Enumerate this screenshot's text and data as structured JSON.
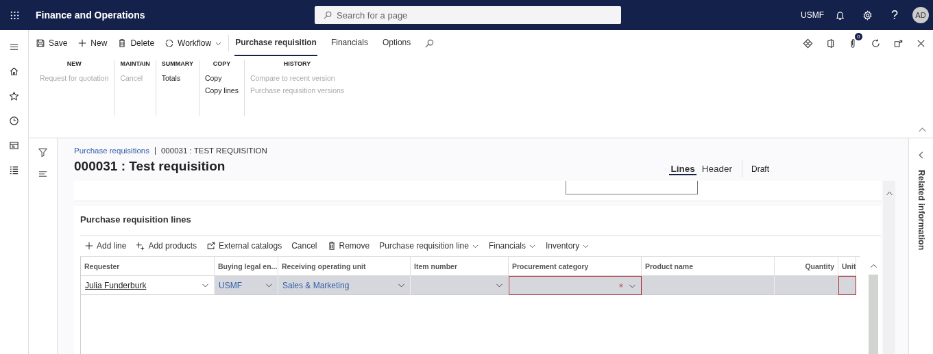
{
  "app": {
    "title": "Finance and Operations",
    "search": {
      "placeholder": "Search for a page"
    },
    "company": "USMF",
    "help": "?",
    "user_initials": "AD"
  },
  "nav_rail": [
    {
      "kind": "menu"
    },
    {
      "kind": "home"
    },
    {
      "kind": "star"
    },
    {
      "kind": "clock"
    },
    {
      "kind": "workspace"
    },
    {
      "kind": "list"
    }
  ],
  "action_pane": {
    "buttons": [
      {
        "label": "Save",
        "kind": "save",
        "dropdown": false
      },
      {
        "label": "New",
        "kind": "plus",
        "dropdown": false
      },
      {
        "label": "Delete",
        "kind": "trash",
        "dropdown": false
      },
      {
        "label": "Workflow",
        "kind": "workflow",
        "dropdown": true
      }
    ],
    "tabs": [
      {
        "label": "Purchase requisition",
        "selected": true
      },
      {
        "label": "Financials",
        "selected": false
      },
      {
        "label": "Options",
        "selected": false
      }
    ],
    "attachments_count": "0",
    "groups": [
      {
        "title": "NEW",
        "items": [
          {
            "label": "Request for quotation",
            "disabled": true
          }
        ]
      },
      {
        "title": "MAINTAIN",
        "items": [
          {
            "label": "Cancel",
            "disabled": true
          }
        ]
      },
      {
        "title": "SUMMARY",
        "items": [
          {
            "label": "Totals",
            "disabled": false
          }
        ]
      },
      {
        "title": "COPY",
        "items": [
          {
            "label": "Copy",
            "disabled": false
          },
          {
            "label": "Copy lines",
            "disabled": false
          }
        ]
      },
      {
        "title": "HISTORY",
        "items": [
          {
            "label": "Compare to recent version",
            "disabled": true
          },
          {
            "label": "Purchase requisition versions",
            "disabled": true
          }
        ]
      }
    ]
  },
  "breadcrumb": {
    "link": "Purchase requisitions",
    "current": "000031 : TEST REQUISITION"
  },
  "page_title": "000031 : Test requisition",
  "view_tabs": [
    {
      "label": "Lines",
      "selected": true
    },
    {
      "label": "Header",
      "selected": false
    }
  ],
  "status": "Draft",
  "lines": {
    "title": "Purchase requisition lines",
    "toolbar": [
      {
        "label": "Add line",
        "kind": "plus",
        "dropdown": false
      },
      {
        "label": "Add products",
        "kind": "addmany",
        "dropdown": false
      },
      {
        "label": "External catalogs",
        "kind": "external",
        "dropdown": false
      },
      {
        "label": "Cancel",
        "kind": "text",
        "dropdown": false
      },
      {
        "label": "Remove",
        "kind": "trash",
        "dropdown": false
      },
      {
        "label": "Purchase requisition line",
        "kind": "text",
        "dropdown": true
      },
      {
        "label": "Financials",
        "kind": "text",
        "dropdown": true
      },
      {
        "label": "Inventory",
        "kind": "text",
        "dropdown": true
      }
    ],
    "columns": [
      {
        "label": "Requester"
      },
      {
        "label": "Buying legal en..."
      },
      {
        "label": "Receiving operating unit"
      },
      {
        "label": "Item number"
      },
      {
        "label": "Procurement category"
      },
      {
        "label": "Product name"
      },
      {
        "label": "Quantity"
      },
      {
        "label": "Unit"
      }
    ],
    "rows": [
      {
        "selected": true,
        "cells": [
          {
            "kind": "input",
            "value": "Julia Funderburk",
            "dropdown": true,
            "required": false
          },
          {
            "kind": "link",
            "value": "USMF",
            "dropdown": true,
            "required": false
          },
          {
            "kind": "link",
            "value": "Sales & Marketing",
            "dropdown": true,
            "required": false
          },
          {
            "kind": "text",
            "dropdown": true,
            "required": false
          },
          {
            "kind": "text",
            "dropdown": true,
            "required": true
          },
          {
            "kind": "text",
            "dropdown": false,
            "required": false
          },
          {
            "kind": "text",
            "dropdown": false,
            "required": false
          },
          {
            "kind": "text",
            "dropdown": false,
            "required": true
          }
        ]
      }
    ]
  },
  "related_panel": {
    "title": "Related information"
  }
}
